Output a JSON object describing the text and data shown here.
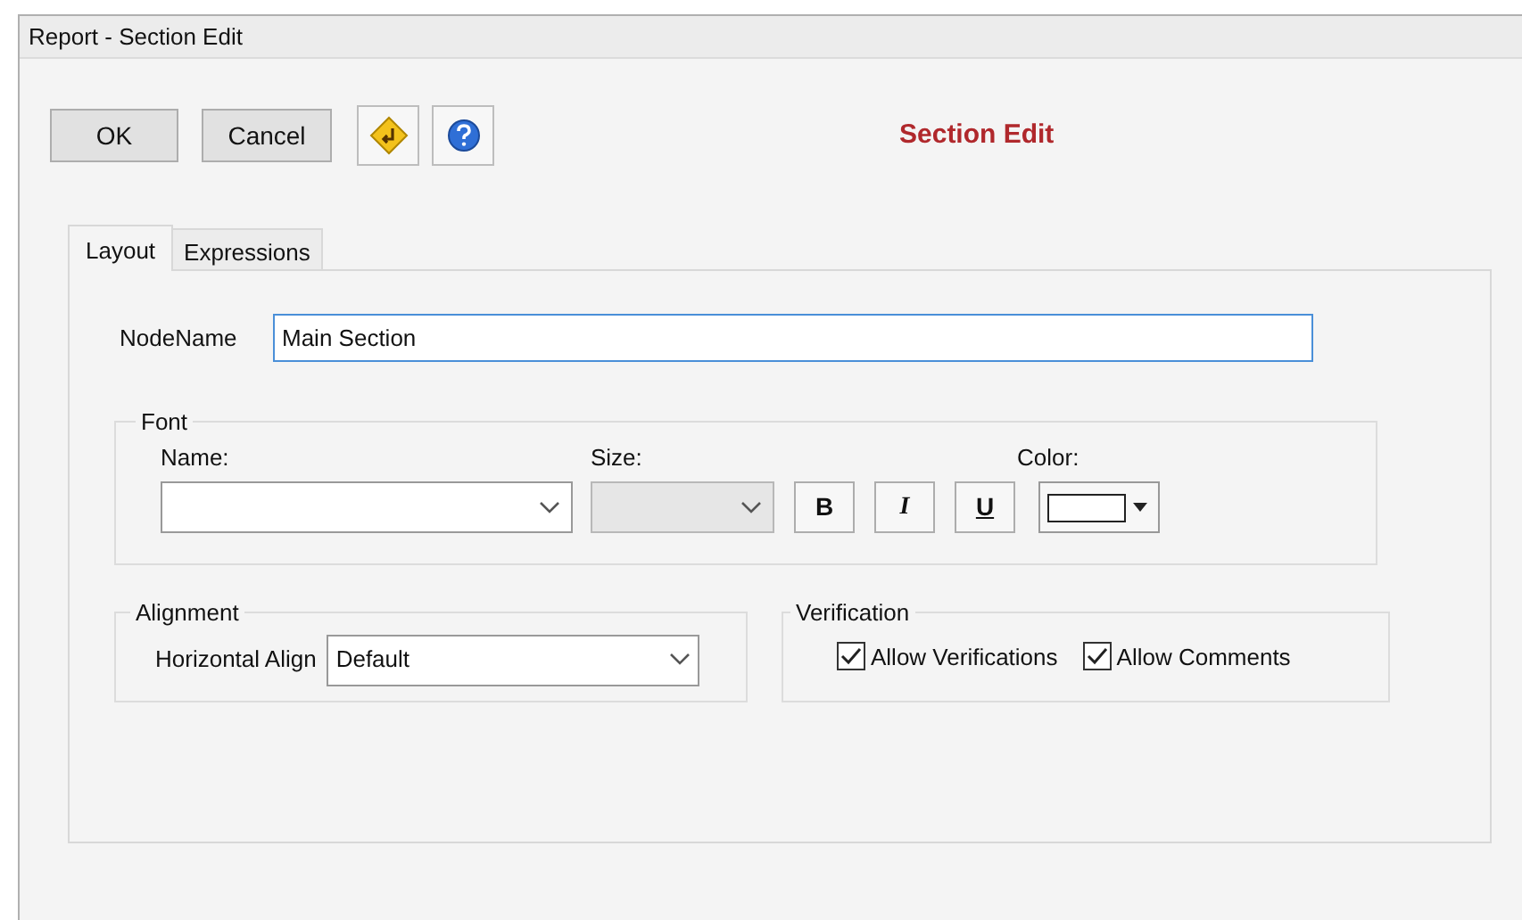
{
  "window": {
    "title": "Report - Section Edit"
  },
  "toolbar": {
    "buttons": [
      "OK",
      "Cancel"
    ],
    "heading": "Section Edit"
  },
  "tabs": [
    {
      "label": "Layout",
      "selected": true
    },
    {
      "label": "Expressions",
      "selected": false
    }
  ],
  "node_name": {
    "label": "NodeName",
    "value": "Main Section"
  },
  "font": {
    "title": "Font",
    "name_label": "Name:",
    "size_label": "Size:",
    "color_label": "Color:",
    "size_disabled": true,
    "styles": [
      {
        "kind": "bold",
        "label": "B"
      },
      {
        "kind": "italic",
        "label": "I"
      },
      {
        "kind": "underline",
        "label": "U"
      }
    ]
  },
  "alignment": {
    "title": "Alignment",
    "label": "Horizontal Align",
    "value": "Default"
  },
  "verification": {
    "title": "Verification",
    "options": [
      {
        "label": "Allow Verifications",
        "checked": true
      },
      {
        "label": "Allow Comments",
        "checked": true
      }
    ]
  }
}
